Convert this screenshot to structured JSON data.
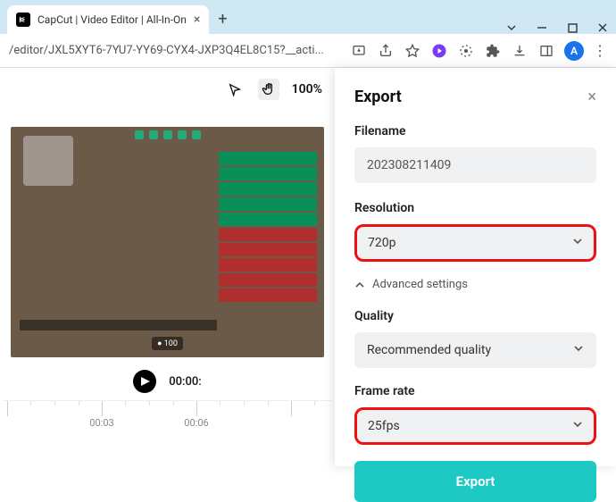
{
  "window": {
    "tab_title": "CapCut | Video Editor | All-In-On"
  },
  "address_bar": {
    "url": "/editor/JXL5XYT6-7YU7-YY69-CYX4-JXP3Q4EL8C15?__acti...",
    "avatar_letter": "A"
  },
  "editor": {
    "zoom": "100%",
    "time_display": "00:00:",
    "timeline_ticks": [
      "00:03",
      "00:06"
    ],
    "hud_ammo": "100"
  },
  "export": {
    "title": "Export",
    "filename_label": "Filename",
    "filename_value": "202308211409",
    "resolution_label": "Resolution",
    "resolution_value": "720p",
    "advanced_label": "Advanced settings",
    "quality_label": "Quality",
    "quality_value": "Recommended quality",
    "framerate_label": "Frame rate",
    "framerate_value": "25fps",
    "export_button": "Export"
  }
}
